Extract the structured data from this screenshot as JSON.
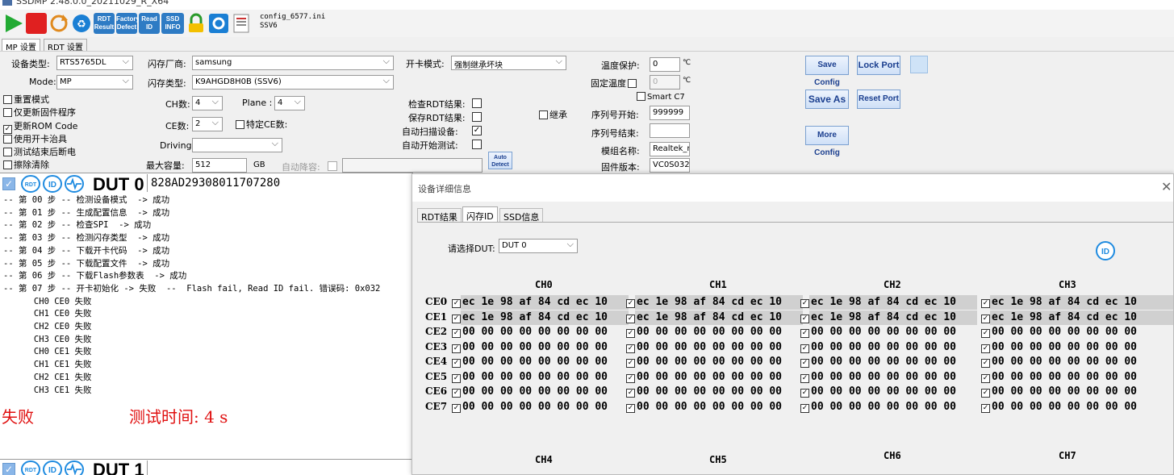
{
  "window": {
    "title": "SSDMP 2.48.0.0_20211029_R_X64"
  },
  "toolbar": {
    "rdt_result": "RDT Result",
    "factory_defect": "Factory Defect",
    "read_id": "Read ID",
    "ssd_info": "SSD INFO",
    "config_file": "config_6577.ini",
    "config_sub": "SSV6"
  },
  "tabs": {
    "mp": "MP 设置",
    "rdt": "RDT 设置"
  },
  "config": {
    "device_type_label": "设备类型:",
    "device_type": "RTS5765DL",
    "mode_label": "Mode:",
    "mode": "MP",
    "flash_vendor_label": "闪存厂商:",
    "flash_vendor": "samsung",
    "flash_type_label": "闪存类型:",
    "flash_type": "K9AHGD8H0B (SSV6)",
    "open_mode_label": "开卡模式:",
    "open_mode": "强制继承坏块",
    "ch_label": "CH数:",
    "ch": "4",
    "plane_label": "Plane :",
    "plane": "4",
    "ce_label": "CE数:",
    "ce": "2",
    "special_ce_label": "特定CE数:",
    "driving_label": "Driving:",
    "driving": "",
    "max_cap_label": "最大容量:",
    "max_cap": "512",
    "gb": "GB",
    "auto_downgrade_label": "自动降容:",
    "checkboxes": [
      "重置模式",
      "仅更新固件程序",
      "更新ROM Code",
      "使用开卡治具",
      "测试结束后断电",
      "擦除清除"
    ],
    "check_rdt": "检查RDT结果:",
    "save_rdt": "保存RDT结果:",
    "auto_scan": "自动扫描设备:",
    "auto_start": "自动开始测试:",
    "auto_detect": "Auto Detect",
    "inherit": "继承",
    "temp_protect_label": "温度保护:",
    "temp_protect": "0",
    "fixed_temp_label": "固定温度",
    "fixed_temp": "0",
    "celsius": "℃",
    "smart_c7": "Smart C7",
    "sn_start_label": "序列号开始:",
    "sn_start": "999999",
    "sn_end_label": "序列号结束:",
    "sn_end": "",
    "module_name_label": "模组名称:",
    "module_name": "Realtek_r",
    "fw_version_label": "固件版本:",
    "fw_version": "VC0S032",
    "save_config": "Save Config",
    "lock_port": "Lock Port",
    "save_as": "Save As",
    "reset_port": "Reset Port",
    "more_config": "More Config"
  },
  "dut": {
    "title": "DUT 0",
    "sn": "828AD29308011707280",
    "title2": "DUT 1",
    "log": [
      "-- 第 00 步 -- 检测设备模式  -> 成功",
      "-- 第 01 步 -- 生成配置信息  -> 成功",
      "-- 第 02 步 -- 检查SPI  -> 成功",
      "-- 第 03 步 -- 检测闪存类型  -> 成功",
      "-- 第 04 步 -- 下载开卡代码  -> 成功",
      "-- 第 05 步 -- 下载配置文件  -> 成功",
      "-- 第 06 步 -- 下载Flash参数表  -> 成功",
      "-- 第 07 步 -- 开卡初始化 -> 失败  --  Flash fail, Read ID fail. 错误码: 0x032",
      "      CH0 CE0 失败",
      "      CH1 CE0 失败",
      "      CH2 CE0 失败",
      "      CH3 CE0 失败",
      "      CH0 CE1 失败",
      "      CH1 CE1 失败",
      "      CH2 CE1 失败",
      "      CH3 CE1 失败"
    ],
    "result": "失败",
    "time": "测试时间: 4 s"
  },
  "dialog": {
    "title": "设备详细信息",
    "tabs": [
      "RDT结果",
      "闪存ID",
      "SSD信息"
    ],
    "select_label": "请选择DUT:",
    "select_value": "DUT 0",
    "channels": [
      "CH0",
      "CH1",
      "CH2",
      "CH3"
    ],
    "channels2": [
      "CH4",
      "CH5",
      "CH6",
      "CH7"
    ],
    "ces": [
      "CE0",
      "CE1",
      "CE2",
      "CE3",
      "CE4",
      "CE5",
      "CE6",
      "CE7"
    ],
    "id_row": "ec 1e 98 af 84 cd ec 10",
    "zero_row": "00 00 00 00 00 00 00 00"
  }
}
